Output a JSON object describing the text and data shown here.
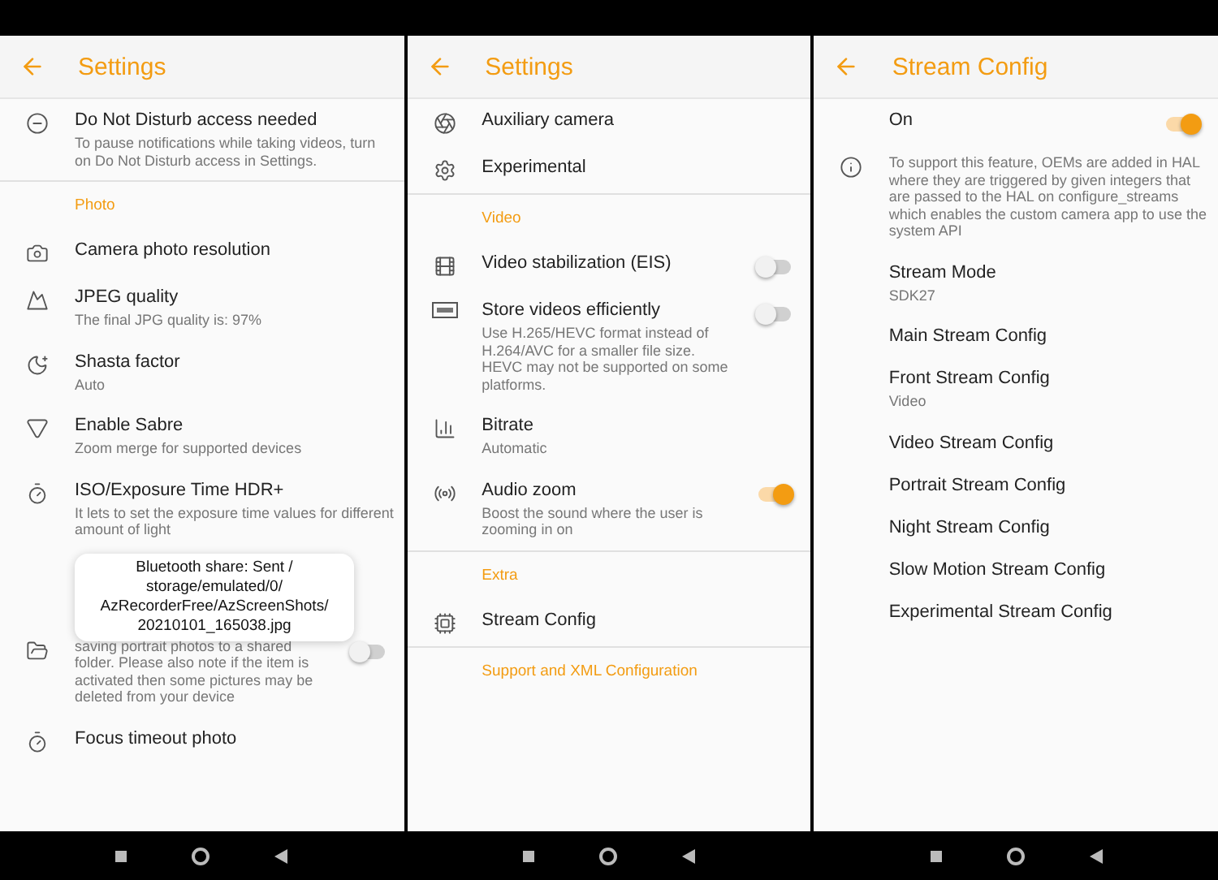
{
  "screens": [
    {
      "title": "Settings",
      "items": [
        {
          "kind": "item",
          "title": "Do Not Disturb access needed",
          "subtitle": "To pause notifications while taking videos, turn on Do Not Disturb access in Settings."
        },
        {
          "kind": "divider"
        },
        {
          "kind": "header",
          "title": "Photo"
        },
        {
          "kind": "item",
          "title": "Camera photo resolution"
        },
        {
          "kind": "item",
          "title": "JPEG quality",
          "subtitle": "The final JPG quality is: 97%"
        },
        {
          "kind": "item",
          "title": "Shasta factor",
          "subtitle": "Auto"
        },
        {
          "kind": "item",
          "title": "Enable Sabre",
          "subtitle": "Zoom merge for supported devices"
        },
        {
          "kind": "item",
          "title": "ISO/Exposure Time HDR+",
          "subtitle": "It lets to set the exposure time values for different amount of light"
        },
        {
          "kind": "item",
          "subtitle": "saving portrait photos to a shared folder. Please also note if the item is activated then some pictures may be deleted from your device",
          "toggle": {
            "on": false
          },
          "toast": "Bluetooth share: Sent / storage/emulated/0/ AzRecorderFree/AzScreenShots/ 20210101_165038.jpg"
        },
        {
          "kind": "item",
          "title": "Focus timeout photo"
        }
      ]
    },
    {
      "title": "Settings",
      "items": [
        {
          "kind": "item",
          "title": "Auxiliary camera"
        },
        {
          "kind": "item",
          "title": "Experimental"
        },
        {
          "kind": "divider"
        },
        {
          "kind": "header",
          "title": "Video"
        },
        {
          "kind": "item",
          "title": "Video stabilization (EIS)",
          "toggle": {
            "on": false
          }
        },
        {
          "kind": "item",
          "title": "Store videos efficiently",
          "subtitle": "Use H.265/HEVC format instead of H.264/AVC for a smaller file size. HEVC may not be supported on some platforms.",
          "toggle": {
            "on": false
          }
        },
        {
          "kind": "item",
          "title": "Bitrate",
          "subtitle": "Automatic"
        },
        {
          "kind": "item",
          "title": "Audio zoom",
          "subtitle": "Boost the sound where the user is zooming in on",
          "toggle": {
            "on": true
          }
        },
        {
          "kind": "divider"
        },
        {
          "kind": "header",
          "title": "Extra"
        },
        {
          "kind": "item",
          "title": "Stream Config"
        },
        {
          "kind": "divider"
        },
        {
          "kind": "header",
          "title": "Support and XML Configuration"
        }
      ]
    },
    {
      "title": "Stream Config",
      "items": [
        {
          "kind": "item",
          "title": "On",
          "toggle": {
            "on": true
          }
        },
        {
          "kind": "item",
          "subtitle": "To support this feature, OEMs are added in HAL where they are triggered by given integers that are passed to the HAL on configure_streams which enables the custom camera app to use the system API"
        },
        {
          "kind": "item",
          "title": "Stream Mode",
          "subtitle": "SDK27"
        },
        {
          "kind": "item",
          "title": "Main Stream Config"
        },
        {
          "kind": "item",
          "title": "Front Stream Config",
          "subtitle": "Video"
        },
        {
          "kind": "item",
          "title": "Video Stream Config"
        },
        {
          "kind": "item",
          "title": "Portrait Stream Config"
        },
        {
          "kind": "item",
          "title": "Night Stream Config"
        },
        {
          "kind": "item",
          "title": "Slow Motion Stream Config"
        },
        {
          "kind": "item",
          "title": "Experimental Stream Config"
        }
      ]
    }
  ]
}
